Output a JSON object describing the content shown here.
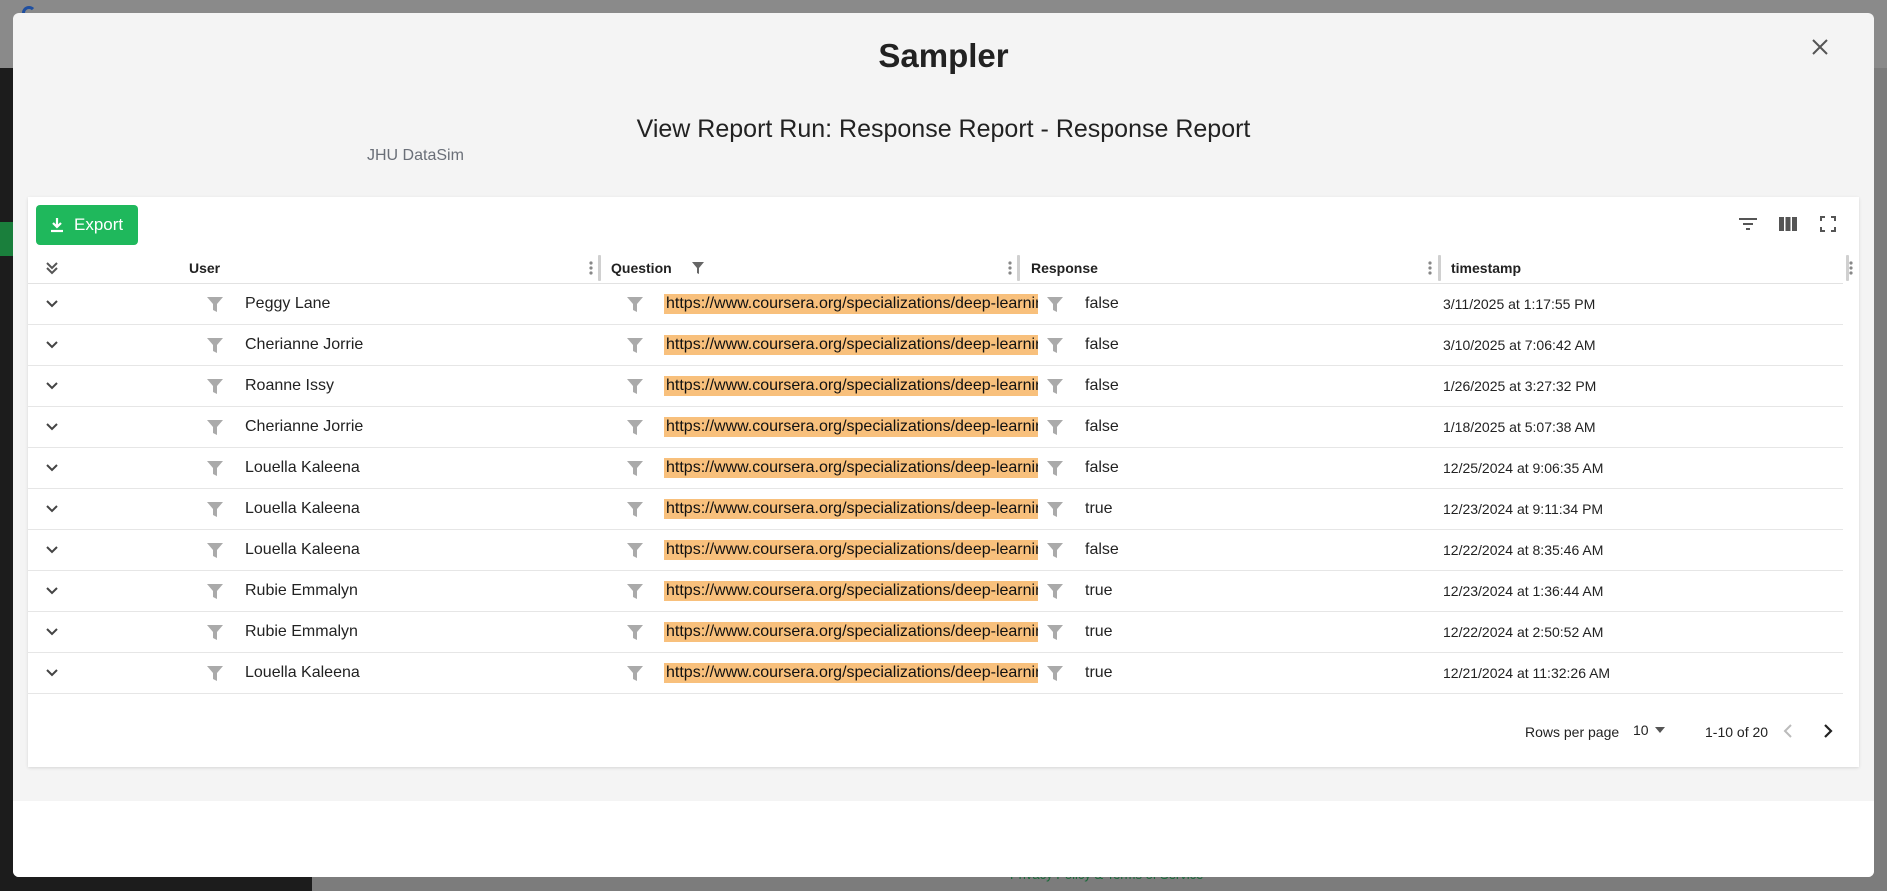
{
  "background": {
    "footer_link": "Privacy Policy & Terms of Service"
  },
  "modal": {
    "title": "Sampler",
    "subtitle": "View Report Run: Response Report - Response Report",
    "org": "JHU DataSim",
    "close_icon": "close-icon"
  },
  "toolbar": {
    "export_label": "Export",
    "icons": [
      "filter-list-icon",
      "columns-icon",
      "fullscreen-icon"
    ]
  },
  "table": {
    "columns": [
      "User",
      "Question",
      "Response",
      "timestamp"
    ],
    "rows": [
      {
        "user": "Peggy Lane",
        "question": "https://www.coursera.org/specializations/deep-learning",
        "response": "false",
        "timestamp": "3/11/2025 at 1:17:55 PM"
      },
      {
        "user": "Cherianne Jorrie",
        "question": "https://www.coursera.org/specializations/deep-learning",
        "response": "false",
        "timestamp": "3/10/2025 at 7:06:42 AM"
      },
      {
        "user": "Roanne Issy",
        "question": "https://www.coursera.org/specializations/deep-learning",
        "response": "false",
        "timestamp": "1/26/2025 at 3:27:32 PM"
      },
      {
        "user": "Cherianne Jorrie",
        "question": "https://www.coursera.org/specializations/deep-learning",
        "response": "false",
        "timestamp": "1/18/2025 at 5:07:38 AM"
      },
      {
        "user": "Louella Kaleena",
        "question": "https://www.coursera.org/specializations/deep-learning",
        "response": "false",
        "timestamp": "12/25/2024 at 9:06:35 AM"
      },
      {
        "user": "Louella Kaleena",
        "question": "https://www.coursera.org/specializations/deep-learning",
        "response": "true",
        "timestamp": "12/23/2024 at 9:11:34 PM"
      },
      {
        "user": "Louella Kaleena",
        "question": "https://www.coursera.org/specializations/deep-learning",
        "response": "false",
        "timestamp": "12/22/2024 at 8:35:46 AM"
      },
      {
        "user": "Rubie Emmalyn",
        "question": "https://www.coursera.org/specializations/deep-learning",
        "response": "true",
        "timestamp": "12/23/2024 at 1:36:44 AM"
      },
      {
        "user": "Rubie Emmalyn",
        "question": "https://www.coursera.org/specializations/deep-learning",
        "response": "true",
        "timestamp": "12/22/2024 at 2:50:52 AM"
      },
      {
        "user": "Louella Kaleena",
        "question": "https://www.coursera.org/specializations/deep-learning",
        "response": "true",
        "timestamp": "12/21/2024 at 11:32:26 AM"
      }
    ]
  },
  "pagination": {
    "rows_per_page_label": "Rows per page",
    "rows_per_page_value": "10",
    "range": "1-10 of 20"
  },
  "colors": {
    "export_bg": "#1fb85c",
    "highlight": "#f8c07c"
  }
}
